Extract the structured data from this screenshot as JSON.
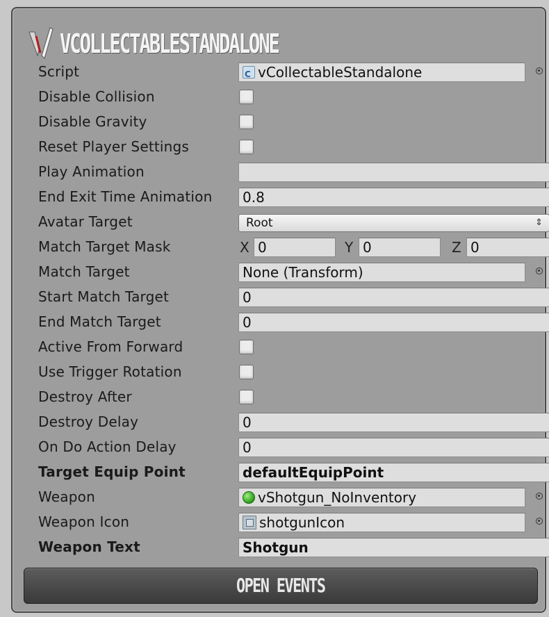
{
  "header": {
    "title": "VCOLLECTABLESTANDALONE",
    "logo_icon": "invector-v-logo"
  },
  "fields": {
    "script": {
      "label": "Script",
      "value": "vCollectableStandalone",
      "icon": "csharp-script-icon"
    },
    "disable_collision": {
      "label": "Disable Collision",
      "checked": false
    },
    "disable_gravity": {
      "label": "Disable Gravity",
      "checked": false
    },
    "reset_player_settings": {
      "label": "Reset Player Settings",
      "checked": false
    },
    "play_animation": {
      "label": "Play Animation",
      "value": ""
    },
    "end_exit_time_animation": {
      "label": "End Exit Time Animation",
      "value": "0.8"
    },
    "avatar_target": {
      "label": "Avatar Target",
      "value": "Root"
    },
    "match_target_mask": {
      "label": "Match Target Mask",
      "x_label": "X",
      "x": "0",
      "y_label": "Y",
      "y": "0",
      "z_label": "Z",
      "z": "0"
    },
    "match_target": {
      "label": "Match Target",
      "value": "None (Transform)"
    },
    "start_match_target": {
      "label": "Start Match Target",
      "value": "0"
    },
    "end_match_target": {
      "label": "End Match Target",
      "value": "0"
    },
    "active_from_forward": {
      "label": "Active From Forward",
      "checked": false
    },
    "use_trigger_rotation": {
      "label": "Use Trigger Rotation",
      "checked": false
    },
    "destroy_after": {
      "label": "Destroy After",
      "checked": false
    },
    "destroy_delay": {
      "label": "Destroy Delay",
      "value": "0"
    },
    "on_do_action_delay": {
      "label": "On Do Action Delay",
      "value": "0"
    },
    "target_equip_point": {
      "label": "Target Equip Point",
      "value": "defaultEquipPoint"
    },
    "weapon": {
      "label": "Weapon",
      "value": "vShotgun_NoInventory",
      "icon": "gameobject-icon"
    },
    "weapon_icon": {
      "label": "Weapon Icon",
      "value": "shotgunIcon",
      "icon": "texture-icon"
    },
    "weapon_text": {
      "label": "Weapon Text",
      "value": "Shotgun"
    }
  },
  "open_events_button": {
    "label": "OPEN EVENTS"
  },
  "colors": {
    "panel_bg": "#9d9d9d",
    "field_bg": "#dedede",
    "button_bg": "#4a4a4a"
  }
}
